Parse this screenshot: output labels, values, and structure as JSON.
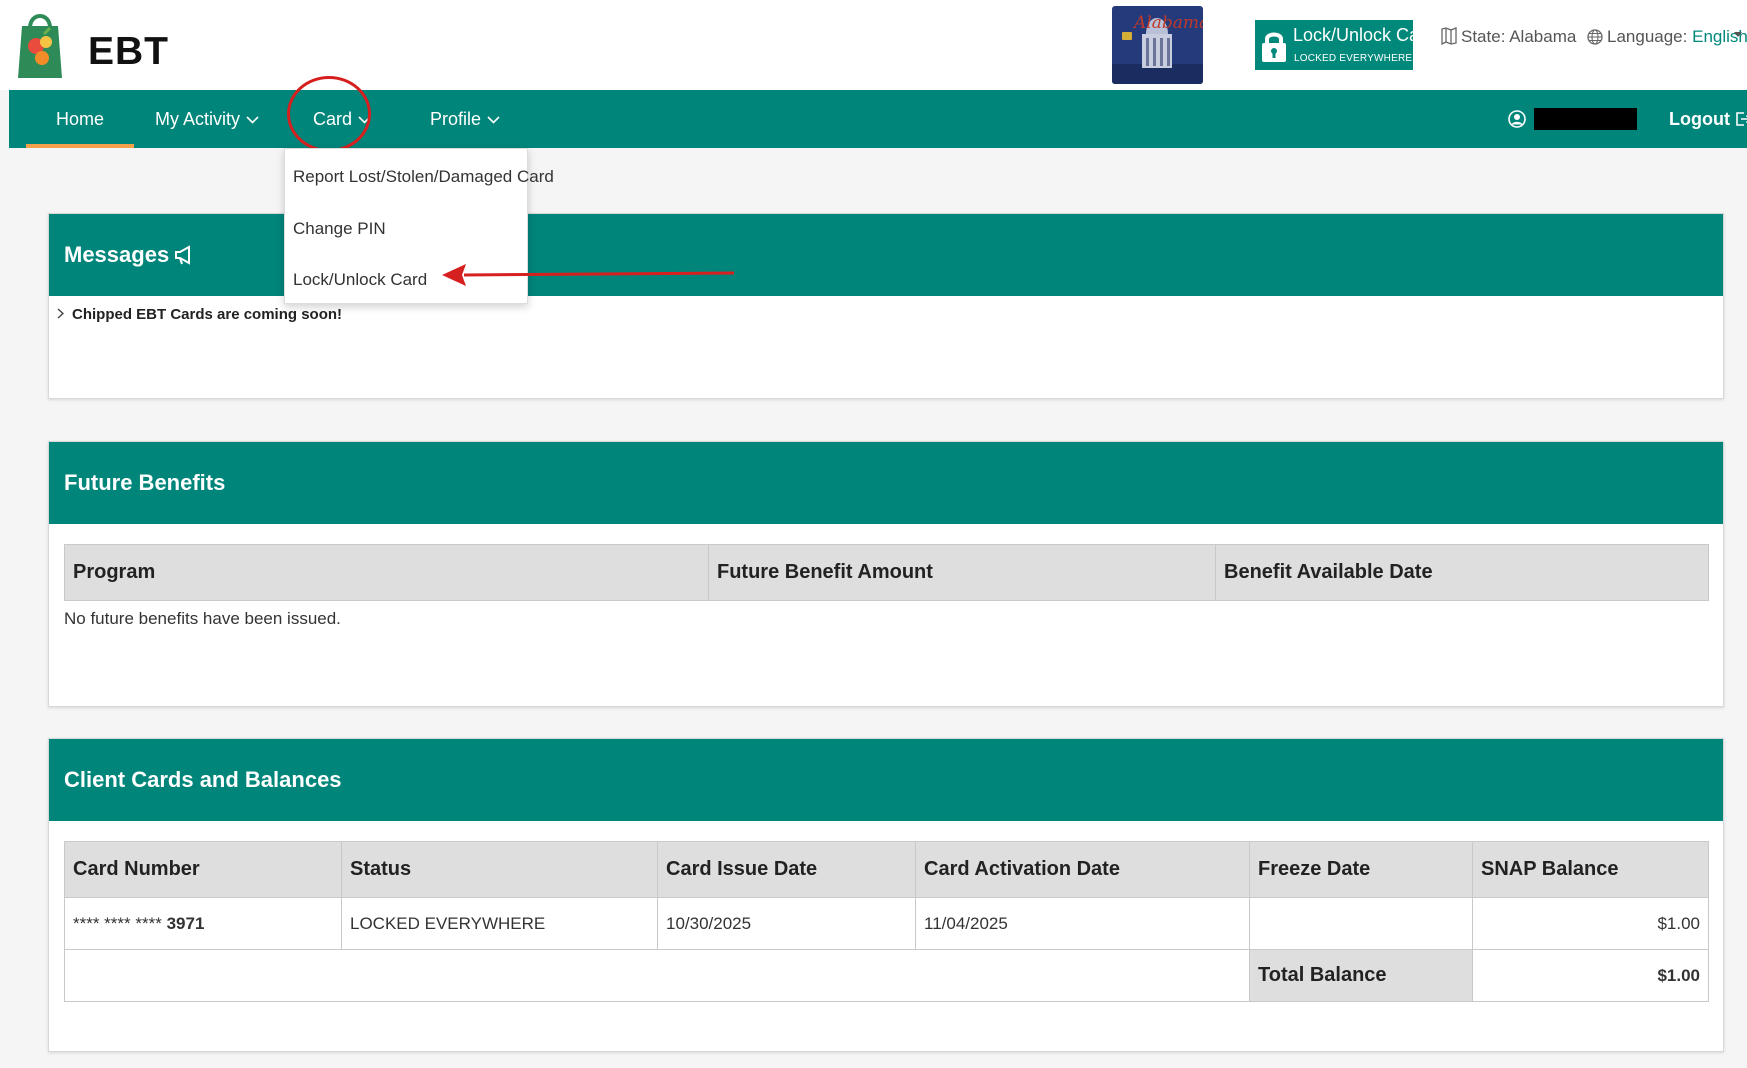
{
  "brand": {
    "logo_text": "EBT",
    "state_card_text": "Alabama"
  },
  "header": {
    "lock_button": {
      "title": "Lock/Unlock Card",
      "subtitle": "LOCKED EVERYWHERE"
    },
    "state_label": "State:",
    "state_value": "Alabama",
    "language_label": "Language:",
    "language_value": "English"
  },
  "nav": {
    "home": "Home",
    "my_activity": "My Activity",
    "card": "Card",
    "profile": "Profile",
    "logout": "Logout"
  },
  "card_menu": {
    "items": [
      "Report Lost/Stolen/Damaged Card",
      "Change PIN",
      "Lock/Unlock Card"
    ]
  },
  "messages": {
    "title": "Messages",
    "items": [
      "Chipped EBT Cards are coming soon!"
    ]
  },
  "future_benefits": {
    "title": "Future Benefits",
    "columns": [
      "Program",
      "Future Benefit Amount",
      "Benefit Available Date"
    ],
    "empty_text": "No future benefits have been issued."
  },
  "client_cards": {
    "title": "Client Cards and Balances",
    "columns": [
      "Card Number",
      "Status",
      "Card Issue Date",
      "Card Activation Date",
      "Freeze Date",
      "SNAP Balance"
    ],
    "rows": [
      {
        "card_masked": "**** **** ****",
        "card_last4": "3971",
        "status": "LOCKED EVERYWHERE",
        "issue_date": "10/30/2025",
        "activation_date": "11/04/2025",
        "freeze_date": "",
        "snap_balance": "$1.00"
      }
    ],
    "total_label": "Total Balance",
    "total_value": "$1.00"
  },
  "colors": {
    "primary": "#00857a",
    "accent": "#f5a04a",
    "annotation": "#d6201f"
  }
}
